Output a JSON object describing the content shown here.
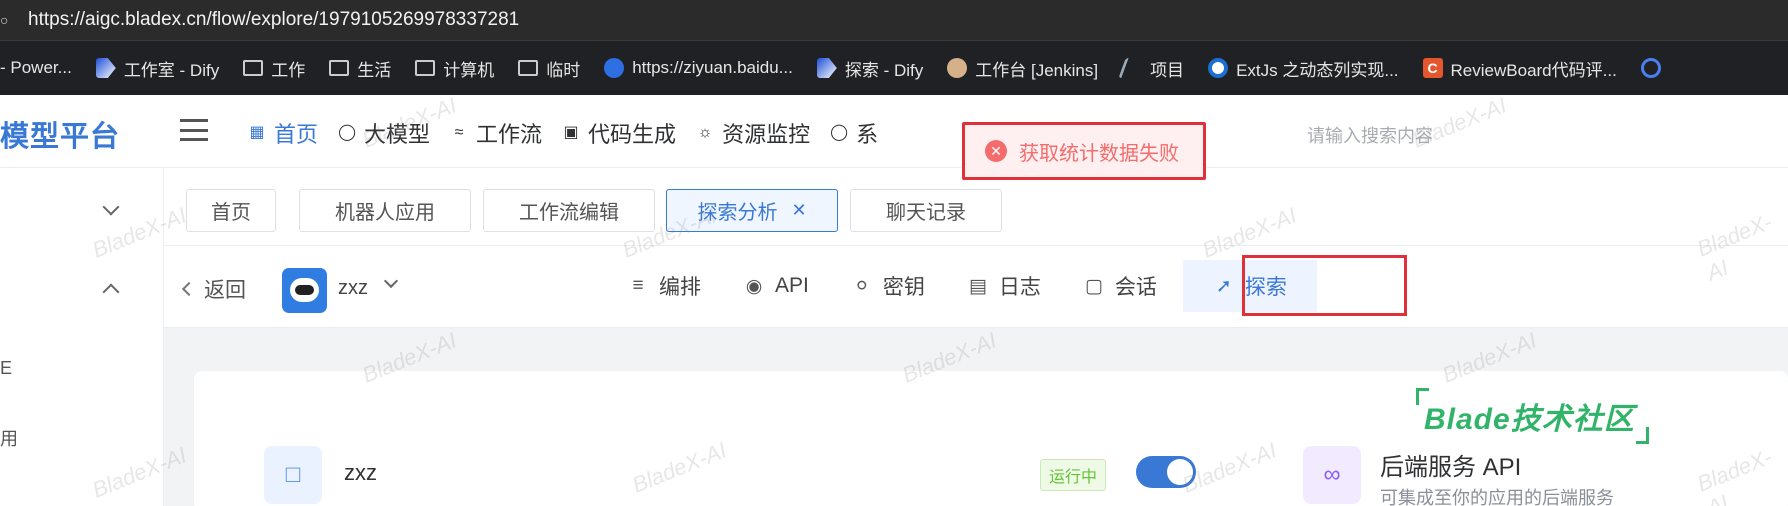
{
  "browser": {
    "url": "https://aigc.bladex.cn/flow/explore/1979105269978337281",
    "bookmarks": [
      "- Power...",
      "工作室 - Dify",
      "工作",
      "生活",
      "计算机",
      "临时",
      "https://ziyuan.baidu...",
      "探索 - Dify",
      "工作台 [Jenkins]",
      "项目",
      "ExtJs 之动态列实现...",
      "ReviewBoard代码评..."
    ]
  },
  "app": {
    "logo": "模型平台",
    "nav": [
      "首页",
      "大模型",
      "工作流",
      "代码生成",
      "资源监控",
      "系"
    ],
    "search_placeholder": "请输入搜索内容",
    "sidebar_frags": [
      "E",
      "用"
    ]
  },
  "tabs": [
    "首页",
    "机器人应用",
    "工作流编辑",
    "探索分析",
    "聊天记录"
  ],
  "subheader": {
    "back": "返回",
    "app_name": "zxz",
    "tabs": [
      "编排",
      "API",
      "密钥",
      "日志",
      "会话",
      "探索"
    ]
  },
  "toast": {
    "message": "获取统计数据失败"
  },
  "card": {
    "name": "zxz",
    "status": "运行中",
    "switch_on": true,
    "api_title": "后端服务 API",
    "api_subtitle": "可集成至你的应用的后端服务"
  },
  "overlay": {
    "community": "Blade技术社区"
  },
  "watermark": "BladeX-AI",
  "colors": {
    "accent": "#3a78d6",
    "error": "#f56c6c",
    "success": "#67c23a",
    "highlight_box": "#e0303a"
  }
}
